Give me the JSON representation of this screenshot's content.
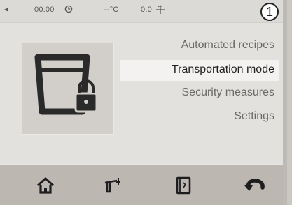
{
  "status_bar": {
    "back_glyph": "◂",
    "time": "00:00",
    "temperature": "--°C",
    "weight": "0.0",
    "step_number": "1"
  },
  "menu": {
    "items": [
      {
        "label": "Automated recipes",
        "active": false
      },
      {
        "label": "Transportation mode",
        "active": true
      },
      {
        "label": "Security measures",
        "active": false
      },
      {
        "label": "Settings",
        "active": false
      }
    ]
  },
  "illustration": {
    "icon": "locked-bowl-icon"
  },
  "bottom_nav": [
    {
      "icon": "home-icon"
    },
    {
      "icon": "scale-icon"
    },
    {
      "icon": "recipe-book-icon"
    },
    {
      "icon": "return-icon"
    }
  ],
  "colors": {
    "screen_bg": "#e9e7e4",
    "bottom_bar": "#bdb7b2",
    "active_item_bg": "#f3f2f0",
    "icon_dark": "#2b2a2a"
  }
}
